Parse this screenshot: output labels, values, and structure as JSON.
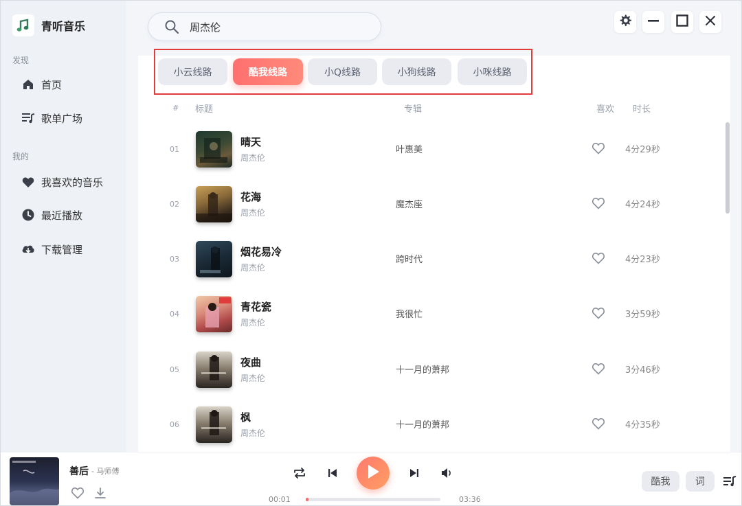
{
  "app": {
    "name": "青听音乐"
  },
  "sidebar": {
    "discover_label": "发现",
    "mine_label": "我的",
    "discover_items": [
      {
        "label": "首页",
        "icon": "home-icon"
      },
      {
        "label": "歌单广场",
        "icon": "playlist-icon"
      }
    ],
    "mine_items": [
      {
        "label": "我喜欢的音乐",
        "icon": "heart-icon"
      },
      {
        "label": "最近播放",
        "icon": "clock-icon"
      },
      {
        "label": "下载管理",
        "icon": "cloud-download-icon"
      }
    ]
  },
  "search": {
    "value": "周杰伦"
  },
  "sources": {
    "items": [
      "小云线路",
      "酷我线路",
      "小Q线路",
      "小狗线路",
      "小咪线路"
    ],
    "active": "酷我线路"
  },
  "table": {
    "headers": {
      "num": "#",
      "title": "标题",
      "album": "专辑",
      "like": "喜欢",
      "duration": "时长"
    },
    "rows": [
      {
        "num": "01",
        "title": "晴天",
        "artist": "周杰伦",
        "album": "叶惠美",
        "duration": "4分29秒"
      },
      {
        "num": "02",
        "title": "花海",
        "artist": "周杰伦",
        "album": "魔杰座",
        "duration": "4分24秒"
      },
      {
        "num": "03",
        "title": "烟花易冷",
        "artist": "周杰伦",
        "album": "跨时代",
        "duration": "4分23秒"
      },
      {
        "num": "04",
        "title": "青花瓷",
        "artist": "周杰伦",
        "album": "我很忙",
        "duration": "3分59秒"
      },
      {
        "num": "05",
        "title": "夜曲",
        "artist": "周杰伦",
        "album": "十一月的萧邦",
        "duration": "3分46秒"
      },
      {
        "num": "06",
        "title": "枫",
        "artist": "周杰伦",
        "album": "十一月的萧邦",
        "duration": "4分35秒"
      }
    ]
  },
  "player": {
    "title": "善后",
    "artist": "- 马师傅",
    "current_time": "00:01",
    "total_time": "03:36",
    "progress": 0.005,
    "source_button": "酷我",
    "lyrics_button": "词"
  },
  "colors": {
    "accent": "#ff6b6b",
    "active_chip_start": "#ff6f6f",
    "highlight_border": "#e23b3b",
    "sidebar_bg": "#eef1f6"
  }
}
